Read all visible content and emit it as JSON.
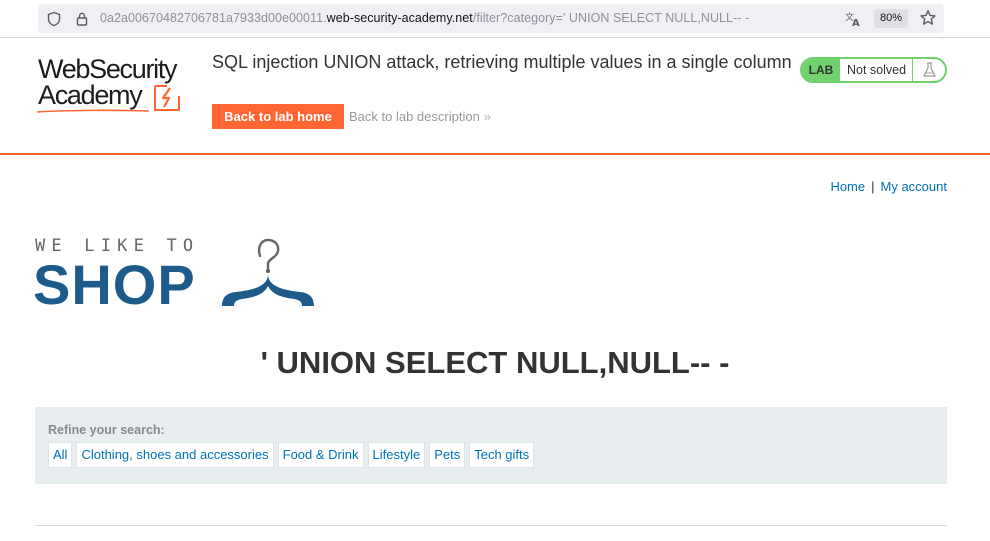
{
  "browser": {
    "url_prefix": "0a2a00670482706781a7933d00e00011.",
    "url_host": "web-security-academy.net",
    "url_path": "/filter?category=' UNION SELECT NULL,NULL-- -",
    "zoom": "80%",
    "icons": [
      "shield-icon",
      "lock-icon",
      "translate-icon",
      "star-icon"
    ]
  },
  "academy": {
    "logo_line1": "WebSecurity",
    "logo_line2": "Academy",
    "lab_title": "SQL injection UNION attack, retrieving multiple values in a single column",
    "back_home_label": "Back to lab home",
    "back_desc_label": "Back to lab description",
    "back_desc_chevron": "»",
    "status_badge": "LAB",
    "status_text": "Not solved",
    "accent_color": "#ff6633",
    "status_color": "#70d16d"
  },
  "nav": {
    "home": "Home",
    "separator": "|",
    "my_account": "My account"
  },
  "shop_logo": {
    "tagline": "WE LIKE TO",
    "word": "SHOP",
    "color": "#1c5b8a"
  },
  "main": {
    "heading": "' UNION SELECT NULL,NULL-- -"
  },
  "filter": {
    "label": "Refine your search:",
    "categories": [
      "All",
      "Clothing, shoes and accessories",
      "Food & Drink",
      "Lifestyle",
      "Pets",
      "Tech gifts"
    ]
  }
}
